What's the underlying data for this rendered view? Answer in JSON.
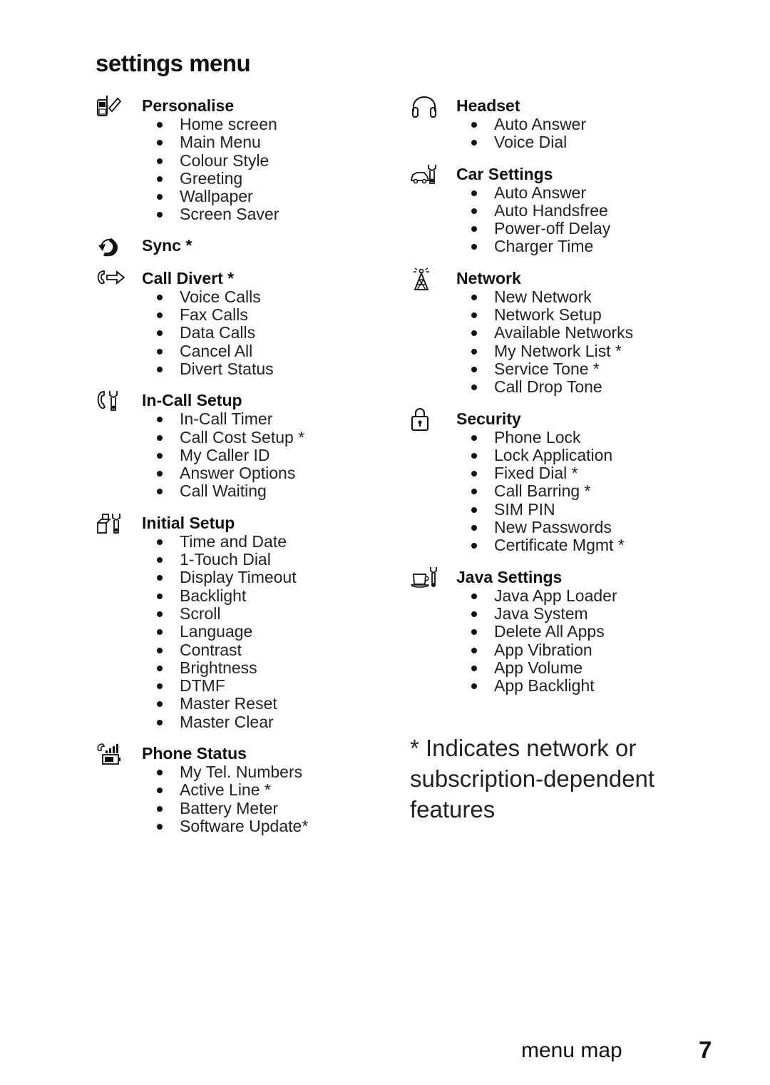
{
  "page": {
    "title": "settings menu",
    "footer_label": "menu map",
    "page_number": "7",
    "note": "* Indicates network or subscription-dependent features"
  },
  "left_column": [
    {
      "icon": "phone-pen-icon",
      "title": "Personalise",
      "items": [
        "Home screen",
        "Main Menu",
        "Colour Style",
        "Greeting",
        "Wallpaper",
        "Screen Saver"
      ]
    },
    {
      "icon": "sync-icon",
      "title": "Sync *",
      "items": []
    },
    {
      "icon": "call-divert-icon",
      "title": "Call Divert *",
      "items": [
        "Voice Calls",
        "Fax Calls",
        "Data Calls",
        "Cancel All",
        "Divert Status"
      ]
    },
    {
      "icon": "in-call-setup-icon",
      "title": "In-Call Setup",
      "items": [
        "In-Call Timer",
        "Call Cost Setup *",
        "My Caller ID",
        "Answer Options",
        "Call Waiting"
      ]
    },
    {
      "icon": "initial-setup-icon",
      "title": "Initial Setup",
      "items": [
        "Time and Date",
        "1-Touch Dial",
        "Display Timeout",
        "Backlight",
        "Scroll",
        "Language",
        "Contrast",
        "Brightness",
        "DTMF",
        "Master Reset",
        "Master Clear"
      ]
    },
    {
      "icon": "phone-status-icon",
      "title": "Phone Status",
      "items": [
        "My Tel. Numbers",
        "Active Line *",
        "Battery Meter",
        "Software Update*"
      ]
    }
  ],
  "right_column": [
    {
      "icon": "headset-icon",
      "title": "Headset",
      "items": [
        "Auto Answer",
        "Voice Dial"
      ]
    },
    {
      "icon": "car-settings-icon",
      "title": "Car Settings",
      "items": [
        "Auto Answer",
        "Auto Handsfree",
        "Power-off Delay",
        "Charger Time"
      ]
    },
    {
      "icon": "network-tower-icon",
      "title": "Network",
      "items": [
        "New Network",
        "Network Setup",
        "Available Networks",
        "My Network List *",
        "Service Tone *",
        "Call Drop Tone"
      ]
    },
    {
      "icon": "padlock-icon",
      "title": "Security",
      "items": [
        "Phone Lock",
        "Lock Application",
        "Fixed Dial *",
        "Call Barring *",
        "SIM PIN",
        "New Passwords",
        "Certificate Mgmt *"
      ]
    },
    {
      "icon": "java-settings-icon",
      "title": "Java Settings",
      "items": [
        "Java App Loader",
        "Java System",
        "Delete All Apps",
        "App Vibration",
        "App Volume",
        "App Backlight"
      ]
    }
  ]
}
